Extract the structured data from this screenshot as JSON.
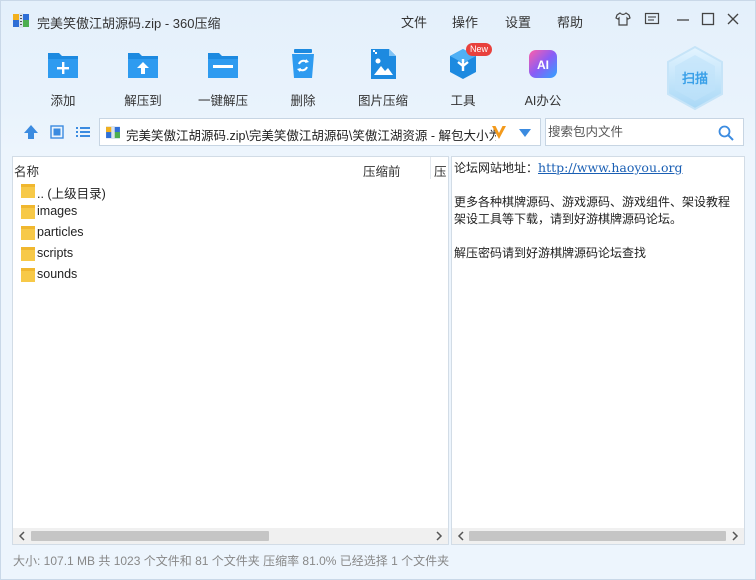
{
  "window": {
    "title": "完美笑傲江胡源码.zip - 360压缩"
  },
  "menu": [
    "文件",
    "操作",
    "设置",
    "帮助"
  ],
  "toolbar": {
    "add": "添加",
    "extract_to": "解压到",
    "one_click": "一键解压",
    "delete": "删除",
    "image_compress": "图片压缩",
    "tools": "工具",
    "new_badge": "New",
    "ai_office": "AI办公",
    "ai_icon_text": "AI",
    "scan": "扫描"
  },
  "address": {
    "path": "完美笑傲江胡源码.zip\\完美笑傲江胡源码\\笑傲江湖资源 - 解包大小为"
  },
  "search": {
    "placeholder": "搜索包内文件"
  },
  "file_list": {
    "columns": [
      "名称",
      "压缩前",
      "压"
    ],
    "items": [
      ".. (上级目录)",
      "images",
      "particles",
      "scripts",
      "sounds"
    ]
  },
  "note": {
    "line1_label": "论坛网站地址：",
    "line1_link": "http://www.haoyou.org",
    "line2": "更多各种棋牌源码、游戏源码、游戏组件、架设教程",
    "line3": "架设工具等下载，请到好游棋牌源码论坛。",
    "line4": "解压密码请到好游棋牌源码论坛查找"
  },
  "status": {
    "text": "大小: 107.1 MB 共 1023 个文件和 81 个文件夹 压缩率 81.0% 已经选择 1 个文件夹"
  },
  "colors": {
    "accent": "#1d8ae0",
    "folder": "#f7c948",
    "badge": "#e8413d"
  }
}
